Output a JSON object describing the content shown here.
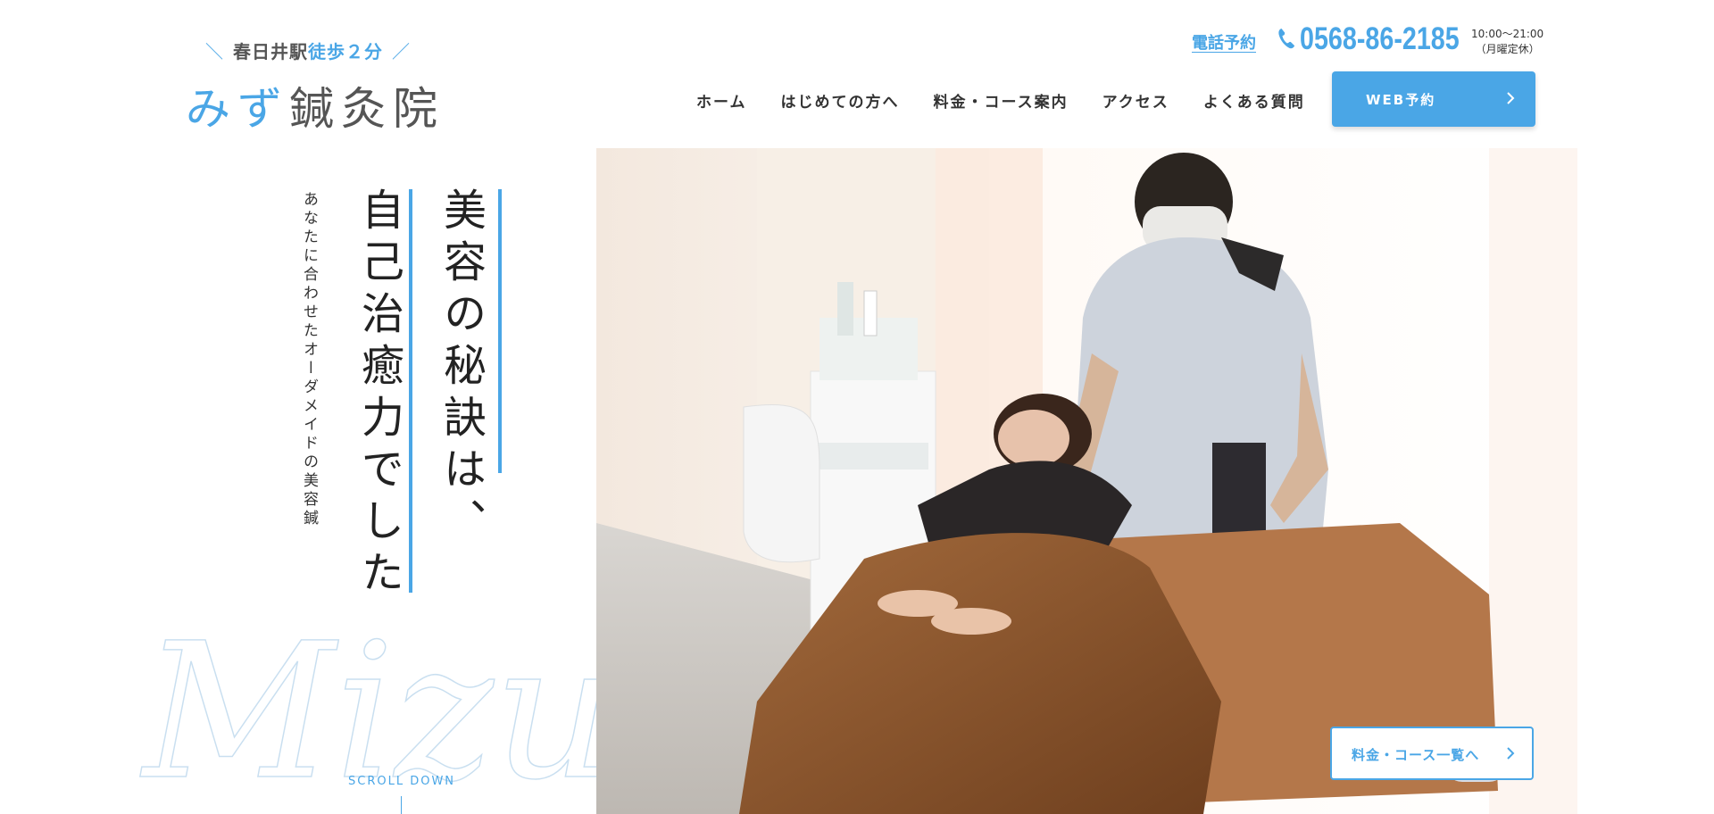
{
  "header": {
    "logo_tag_station": "春日井駅",
    "logo_tag_walk": "徒歩２分",
    "logo_name_accent": "みず",
    "logo_name_rest": "鍼灸院",
    "tel_label": "電話予約",
    "tel_number": "0568-86-2185",
    "hours_line1": "10:00〜21:00",
    "hours_line2": "（月曜定休）"
  },
  "nav": {
    "items": [
      "ホーム",
      "はじめての方へ",
      "料金・コース案内",
      "アクセス",
      "よくある質問"
    ]
  },
  "web_button": {
    "label": "WEB予約"
  },
  "hero": {
    "headline_line1": "美容の秘訣は、",
    "headline_line2": "自己治癒力でした",
    "subtext": "あなたに合わせたオーダメイドの美容鍼",
    "script_word": "Mizu",
    "scroll_label": "SCROLL DOWN",
    "course_button": "料金・コース一覧へ"
  },
  "colors": {
    "accent": "#4aa6e6",
    "text": "#333333"
  },
  "icons": [
    "phone-icon",
    "chevron-right-icon"
  ]
}
